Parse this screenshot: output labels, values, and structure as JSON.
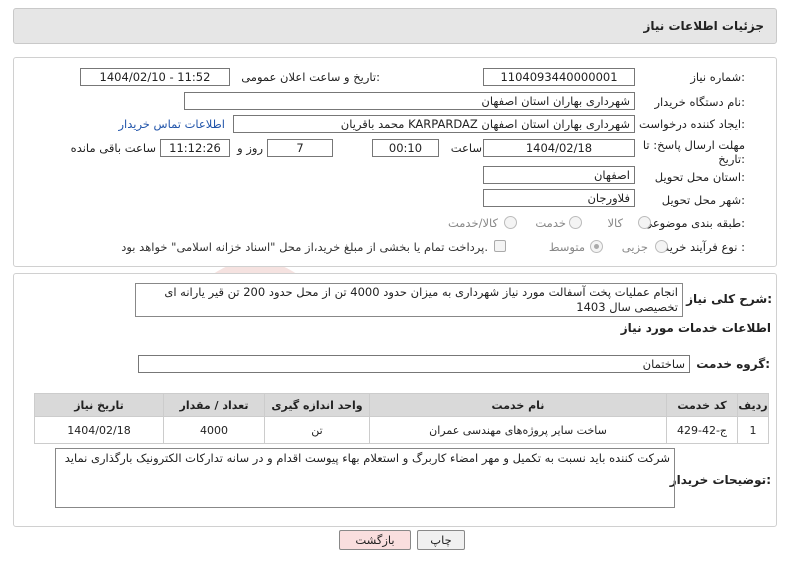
{
  "header": {
    "title": "جزئیات اطلاعات نیاز"
  },
  "form": {
    "need_number_label": "شماره نیاز:",
    "need_number": "1104093440000001",
    "announce_label": "تاریخ و ساعت اعلان عمومی:",
    "announce_value": "1404/02/10 - 11:52",
    "buyer_org_label": "نام دستگاه خریدار:",
    "buyer_org": "شهرداری بهاران استان اصفهان",
    "requester_label": "ایجاد کننده درخواست:",
    "requester": "محمد باقریان KARPARDAZ شهرداری بهاران استان اصفهان",
    "contact_link": "اطلاعات تماس خریدار",
    "deadline_label": "مهلت ارسال پاسخ: تا تاریخ:",
    "deadline_date": "1404/02/18",
    "time_label": "ساعت",
    "deadline_time": "00:10",
    "days_value": "7",
    "days_label": "روز و",
    "remaining_time": "11:12:26",
    "remaining_label": "ساعت باقی مانده",
    "province_label": "استان محل تحویل:",
    "province": "اصفهان",
    "city_label": "شهر محل تحویل:",
    "city": "فلاورجان",
    "category_label": "طبقه بندی موضوعی:",
    "category_options": [
      "کالا",
      "خدمت",
      "کالا/خدمت"
    ],
    "process_label": "نوع فرآیند خرید :",
    "process_options": [
      "جزیی",
      "متوسط"
    ],
    "payment_note": "پرداخت تمام یا بخشی از مبلغ خرید،از محل \"اسناد خزانه اسلامی\" خواهد بود."
  },
  "summary": {
    "label": "شرح کلی نیاز:",
    "text": "انجام عملیات پخت آسفالت مورد نیاز شهرداری به میزان حدود 4000 تن از محل حدود 200 تن قیر یارانه ای تخصیصی سال 1403"
  },
  "services": {
    "section_title": "اطلاعات خدمات مورد نیاز",
    "group_label": "گروه خدمت:",
    "group_value": "ساختمان",
    "columns": [
      "ردیف",
      "کد خدمت",
      "نام خدمت",
      "واحد اندازه گیری",
      "تعداد / مقدار",
      "تاریخ نیاز"
    ],
    "rows": [
      {
        "row": "1",
        "code": "ج-42-429",
        "name": "ساخت سایر پروژه‌های مهندسی عمران",
        "unit": "تن",
        "qty": "4000",
        "date": "1404/02/18"
      }
    ]
  },
  "buyer_notes": {
    "label": "توضیحات خریدار:",
    "text": "شرکت کننده باید  نسبت به تکمیل  و مهر امضاء کاربرگ و استعلام بهاء پیوست اقدام و در سانه تدارکات الکترونیک بارگذاری نماید"
  },
  "buttons": {
    "print": "چاپ",
    "back": "بازگشت"
  },
  "watermark": {
    "text": "AriaTender.net"
  }
}
